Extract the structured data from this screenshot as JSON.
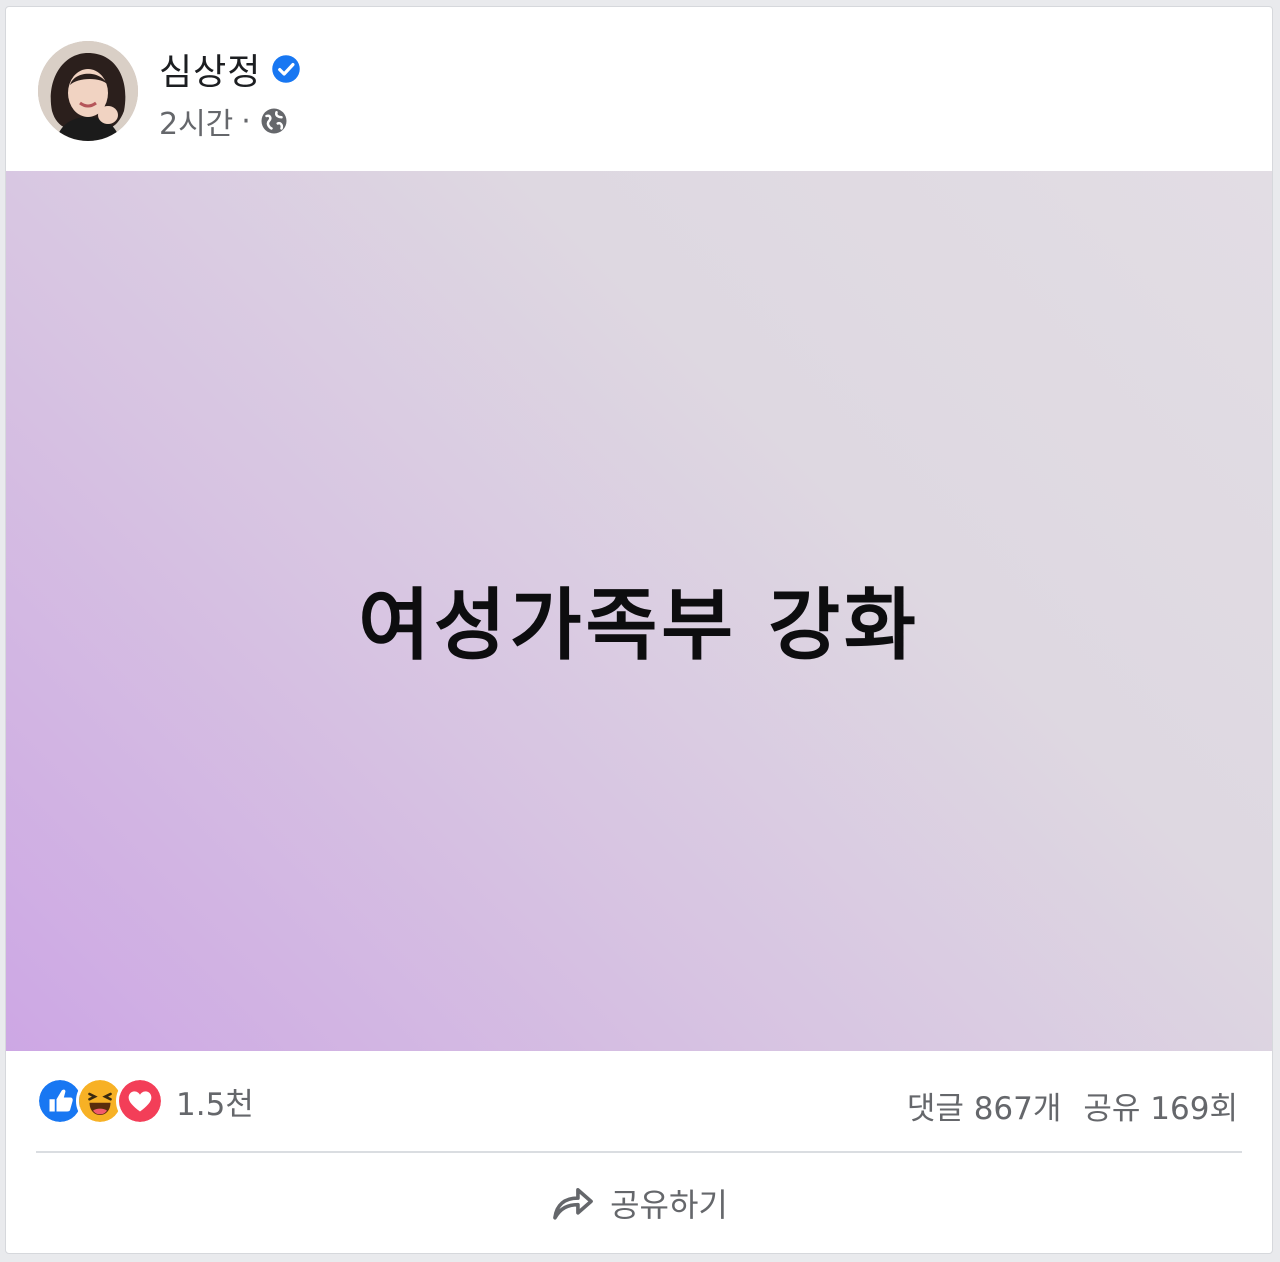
{
  "author": {
    "name": "심상정",
    "verified_icon": "verified-badge-icon"
  },
  "meta": {
    "time": "2시간",
    "separator": "·",
    "audience_icon": "globe-icon"
  },
  "post": {
    "text": "여성가족부 강화"
  },
  "stats": {
    "reaction_count": "1.5천",
    "reaction_icons": [
      "like-icon",
      "haha-icon",
      "love-icon"
    ],
    "comments": "댓글 867개",
    "shares": "공유 169회"
  },
  "actions": {
    "share_label": "공유하기",
    "share_icon": "share-arrow-icon"
  },
  "colors": {
    "verified": "#1877f2",
    "like": "#1877f2",
    "love": "#f33e58",
    "haha": "#f7b125",
    "muted_text": "#65676b"
  }
}
